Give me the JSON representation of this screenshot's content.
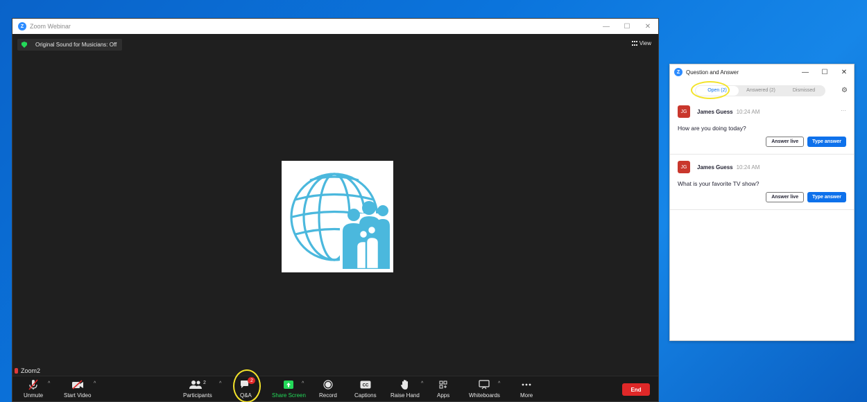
{
  "zoom": {
    "title": "Zoom Webinar",
    "sound_label": "Original Sound for Musicians: Off",
    "view_label": "View",
    "speaker_name": "Zoom2",
    "win_minimize": "—",
    "win_maximize": "☐",
    "win_close": "✕"
  },
  "toolbar": {
    "unmute": "Unmute",
    "start_video": "Start Video",
    "participants": "Participants",
    "participants_count": "2",
    "qa": "Q&A",
    "qa_badge": "2",
    "share_screen": "Share Screen",
    "record": "Record",
    "captions": "Captions",
    "raise_hand": "Raise Hand",
    "apps": "Apps",
    "whiteboards": "Whiteboards",
    "more": "More",
    "end": "End",
    "caret": "^"
  },
  "qa_panel": {
    "title": "Question and Answer",
    "tabs": [
      "Open (2)",
      "Answered (2)",
      "Dismissed"
    ],
    "win_minimize": "—",
    "win_maximize": "☐",
    "win_close": "✕",
    "questions": [
      {
        "initials": "JG",
        "name": "James Guess",
        "time": "10:24 AM",
        "text": "How are you doing today?",
        "more": "···"
      },
      {
        "initials": "JG",
        "name": "James Guess",
        "time": "10:24 AM",
        "text": "What is your favorite TV show?",
        "more": ""
      }
    ],
    "answer_live": "Answer live",
    "type_answer": "Type answer"
  },
  "colors": {
    "accent": "#0e71eb",
    "end_red": "#e02828",
    "share_green": "#23d959",
    "highlight_yellow": "#f3e32a",
    "tile_logo": "#4bb8dd"
  }
}
